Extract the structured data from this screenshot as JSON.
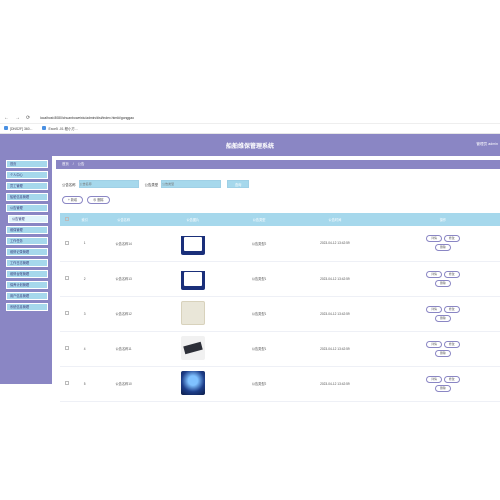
{
  "browser": {
    "url": "localhost:8080/chuanboweixiu/admin/dist/index.html#/gonggao",
    "bookmarks": [
      "[DNS2F] 360...",
      "Exce5 -01 程小方..."
    ]
  },
  "header": {
    "title": "船舶维保管理系统",
    "user": "管理员 admin"
  },
  "sidebar": {
    "items": [
      {
        "label": "首页",
        "sub": false
      },
      {
        "label": "个人中心",
        "sub": false
      },
      {
        "label": "员工管理",
        "sub": false
      },
      {
        "label": "船舶信息管理",
        "sub": false
      },
      {
        "label": "公告管理",
        "sub": false
      },
      {
        "label": "公告管理",
        "sub": true
      },
      {
        "label": "维保管理",
        "sub": false
      },
      {
        "label": "工作任务",
        "sub": false
      },
      {
        "label": "维修记录管理",
        "sub": false
      },
      {
        "label": "工作日志管理",
        "sub": false
      },
      {
        "label": "维修台账管理",
        "sub": false
      },
      {
        "label": "保养计划管理",
        "sub": false
      },
      {
        "label": "用户信息管理",
        "sub": false
      },
      {
        "label": "系统信息管理",
        "sub": false
      }
    ]
  },
  "breadcrumb": {
    "home": "首页",
    "sep": "/",
    "current": "公告"
  },
  "search": {
    "name_label": "公告名称",
    "type_label": "公告类型",
    "name_placeholder": "公告名称",
    "type_placeholder": "公告类型",
    "button": "查询"
  },
  "actions": {
    "add": "+ 新增",
    "delete": "⊗ 删除"
  },
  "table": {
    "headers": [
      "",
      "索引",
      "公告名称",
      "公告图片",
      "公告类型",
      "公告时间",
      "操作"
    ],
    "rows": [
      {
        "index": "1",
        "name": "公告名称14",
        "type": "公告类型2",
        "time": "2023-04-12 13:42:59",
        "image": "a"
      },
      {
        "index": "2",
        "name": "公告名称13",
        "type": "公告类型1",
        "time": "2023-04-12 13:42:59",
        "image": "a"
      },
      {
        "index": "3",
        "name": "公告名称12",
        "type": "公告类型1",
        "time": "2023-04-12 13:42:59",
        "image": "b"
      },
      {
        "index": "4",
        "name": "公告名称11",
        "type": "公告类型1",
        "time": "2023-04-12 13:42:59",
        "image": "c"
      },
      {
        "index": "5",
        "name": "公告名称10",
        "type": "公告类型2",
        "time": "2023-04-12 13:42:59",
        "image": "d"
      }
    ],
    "op_detail": "详情",
    "op_edit": "修改",
    "op_delete": "删除"
  }
}
